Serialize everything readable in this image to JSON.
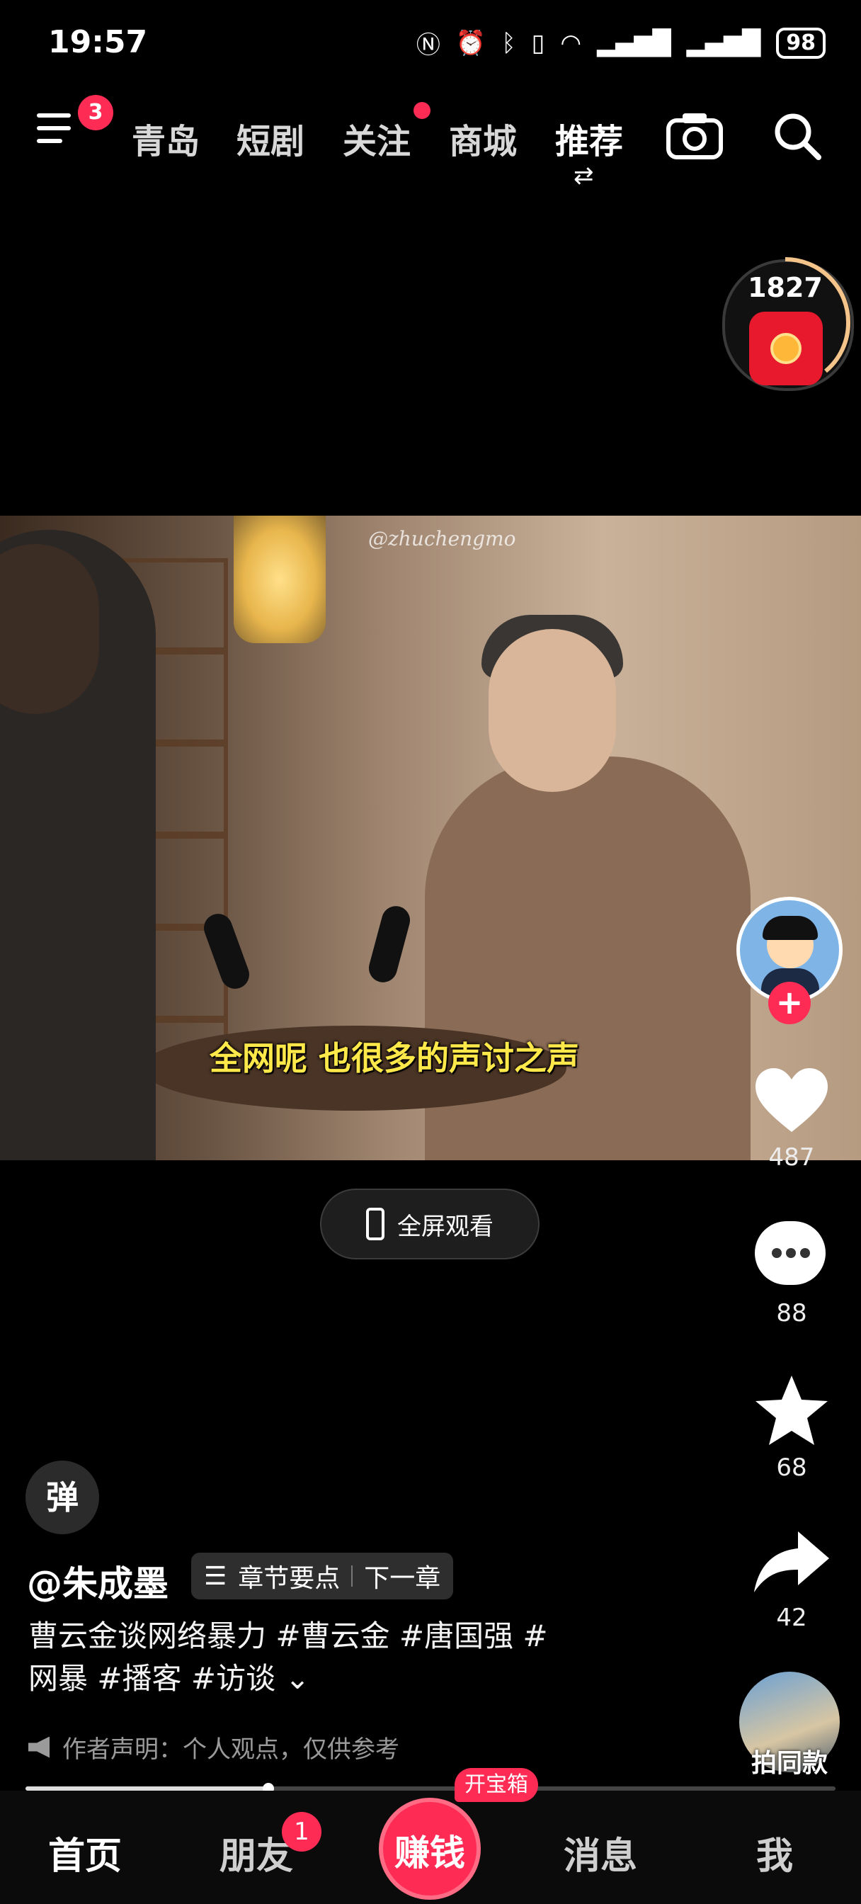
{
  "status_bar": {
    "time": "19:57",
    "battery": "98",
    "icons": [
      "nfc-icon",
      "alarm-icon",
      "bluetooth-icon",
      "vibrate-icon",
      "wifi-icon",
      "signal-icon",
      "signal-icon"
    ]
  },
  "top_nav": {
    "menu_badge": "3",
    "tabs": [
      {
        "label": "青岛",
        "active": false
      },
      {
        "label": "短剧",
        "active": false
      },
      {
        "label": "关注",
        "active": false,
        "dot": true
      },
      {
        "label": "商城",
        "active": false
      },
      {
        "label": "推荐",
        "active": true
      }
    ]
  },
  "earn_widget": {
    "count": "1827"
  },
  "video": {
    "watermark": "@zhuchengmo",
    "subtitle": "全网呢 也很多的声讨之声"
  },
  "fullscreen": {
    "label": "全屏观看"
  },
  "right_rail": {
    "like_count": "487",
    "comment_count": "88",
    "favorite_count": "68",
    "share_count": "42",
    "same_style_label": "拍同款"
  },
  "info": {
    "danmu_label": "弹",
    "author": "@朱成墨",
    "chapter_points": "章节要点",
    "next_chapter": "下一章",
    "caption_line1": "曹云金谈网络暴力 #曹云金 #唐国强 #",
    "caption_line2": "网暴 #播客 #访谈",
    "notice": "作者声明：个人观点，仅供参考"
  },
  "progress": {
    "played_fraction": 0.3
  },
  "bottom_nav": {
    "home": "首页",
    "friends": "朋友",
    "friends_badge": "1",
    "earn": "赚钱",
    "treasure": "开宝箱",
    "messages": "消息",
    "me": "我"
  },
  "colors": {
    "accent": "#fe2c55",
    "subtitle": "#ffe94a",
    "background": "#000000"
  }
}
